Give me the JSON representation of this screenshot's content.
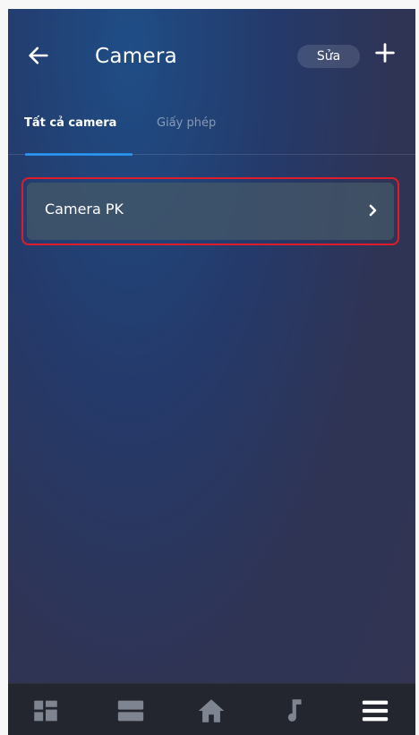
{
  "header": {
    "title": "Camera",
    "edit_label": "Sửa"
  },
  "tabs": [
    {
      "label": "Tất cả camera",
      "active": true
    },
    {
      "label": "Giấy phép",
      "active": false
    }
  ],
  "cameras": [
    {
      "name": "Camera PK"
    }
  ],
  "bottom_nav": [
    {
      "icon": "dashboard-grid-icon"
    },
    {
      "icon": "rooms-list-icon"
    },
    {
      "icon": "home-icon"
    },
    {
      "icon": "music-note-icon"
    },
    {
      "icon": "menu-icon",
      "active": true
    }
  ],
  "colors": {
    "tab_accent": "#1e88e5",
    "highlight_border": "#e01b2b",
    "nav_background": "#23262e"
  }
}
